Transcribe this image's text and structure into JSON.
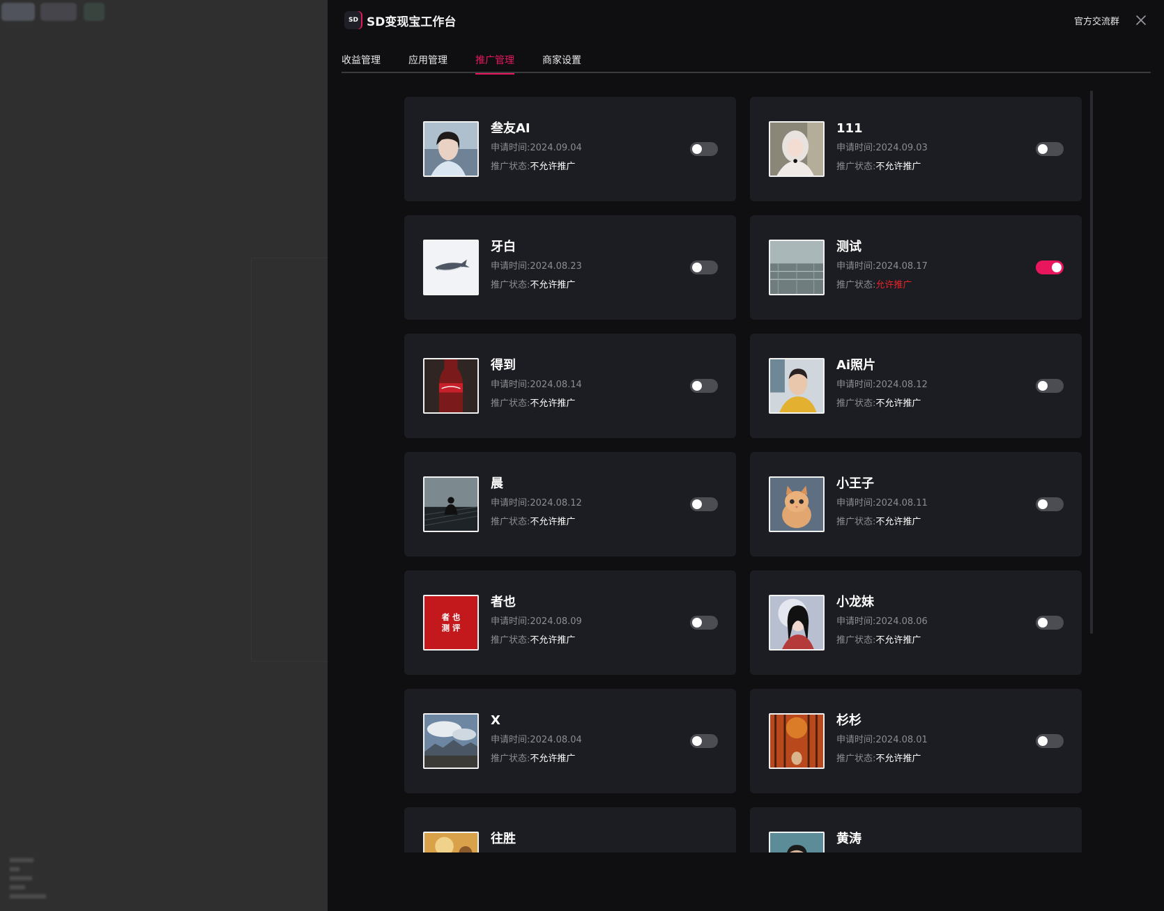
{
  "backdrop": {},
  "header": {
    "logo_text": "SD",
    "title": "SD变现宝工作台",
    "group_link": "官方交流群"
  },
  "tabs": [
    {
      "label": "收益管理",
      "active": false
    },
    {
      "label": "应用管理",
      "active": false
    },
    {
      "label": "推广管理",
      "active": true
    },
    {
      "label": "商家设置",
      "active": false
    }
  ],
  "labels": {
    "date_prefix": "申请时间:",
    "status_prefix": "推广状态:"
  },
  "apps": [
    {
      "name": "叁友AI",
      "date": "2024.09.04",
      "status": "不允许推广",
      "enabled": false,
      "thumb": "portrait-sea"
    },
    {
      "name": "111",
      "date": "2024.09.03",
      "status": "不允许推广",
      "enabled": false,
      "thumb": "portrait-headscarf"
    },
    {
      "name": "牙白",
      "date": "2024.08.23",
      "status": "不允许推广",
      "enabled": false,
      "thumb": "whale"
    },
    {
      "name": "测试",
      "date": "2024.08.17",
      "status": "允许推广",
      "enabled": true,
      "thumb": "rainy-window"
    },
    {
      "name": "得到",
      "date": "2024.08.14",
      "status": "不允许推广",
      "enabled": false,
      "thumb": "cola-bottle"
    },
    {
      "name": "Ai照片",
      "date": "2024.08.12",
      "status": "不允许推广",
      "enabled": false,
      "thumb": "portrait-yellow"
    },
    {
      "name": "晨",
      "date": "2024.08.12",
      "status": "不允许推广",
      "enabled": false,
      "thumb": "dark-figure"
    },
    {
      "name": "小王子",
      "date": "2024.08.11",
      "status": "不允许推广",
      "enabled": false,
      "thumb": "kitten"
    },
    {
      "name": "者也",
      "date": "2024.08.09",
      "status": "不允许推广",
      "enabled": false,
      "thumb": "red-logo",
      "thumb_text": [
        "者 也",
        "测 评"
      ]
    },
    {
      "name": "小龙妹",
      "date": "2024.08.06",
      "status": "不允许推广",
      "enabled": false,
      "thumb": "portrait-moon"
    },
    {
      "name": "X",
      "date": "2024.08.04",
      "status": "不允许推广",
      "enabled": false,
      "thumb": "mountains"
    },
    {
      "name": "杉杉",
      "date": "2024.08.01",
      "status": "不允许推广",
      "enabled": false,
      "thumb": "autumn-forest"
    },
    {
      "name": "往胜",
      "date": "",
      "status": "",
      "enabled": false,
      "thumb": "warm-blur"
    },
    {
      "name": "黄涛",
      "date": "",
      "status": "",
      "enabled": false,
      "thumb": "portrait-man"
    }
  ],
  "colors": {
    "accent": "#e8175d",
    "allowed": "#e8242a",
    "card_bg": "#1c1d22",
    "panel_bg": "#0f0f12"
  }
}
